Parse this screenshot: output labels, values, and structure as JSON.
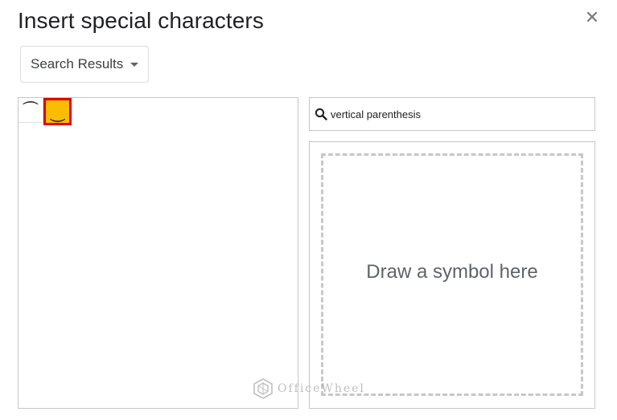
{
  "dialog": {
    "title": "Insert special characters",
    "close_icon": "close-icon"
  },
  "category_dropdown": {
    "selected": "Search Results",
    "icon": "caret-down-icon"
  },
  "results": {
    "characters": [
      {
        "glyph": "⏜",
        "selected": false
      },
      {
        "glyph": "⏝",
        "selected": true
      }
    ],
    "highlight_color": "#fbbc04",
    "selection_border_color": "#e00000"
  },
  "search": {
    "icon": "search-icon",
    "value": "vertical parenthesis"
  },
  "draw_panel": {
    "hint": "Draw a symbol here"
  },
  "watermark": {
    "text": "OfficeWheel"
  }
}
